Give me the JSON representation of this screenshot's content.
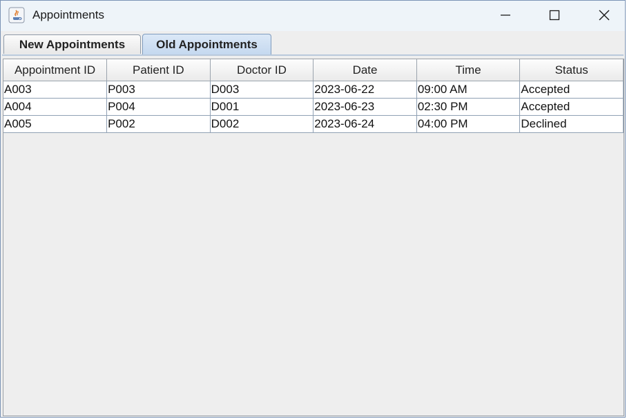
{
  "window": {
    "title": "Appointments",
    "icon": "java-coffee-cup-icon"
  },
  "tabs": [
    {
      "label": "New Appointments",
      "selected": false
    },
    {
      "label": "Old Appointments",
      "selected": true
    }
  ],
  "table": {
    "columns": [
      "Appointment ID",
      "Patient ID",
      "Doctor ID",
      "Date",
      "Time",
      "Status"
    ],
    "rows": [
      [
        "A003",
        "P003",
        "D003",
        "2023-06-22",
        "09:00 AM",
        "Accepted"
      ],
      [
        "A004",
        "P004",
        "D001",
        "2023-06-23",
        "02:30 PM",
        "Accepted"
      ],
      [
        "A005",
        "P002",
        "D002",
        "2023-06-24",
        "04:00 PM",
        "Declined"
      ]
    ]
  },
  "colors": {
    "accent_tab": "#c4d8ef",
    "titlebar": "#eef4f9",
    "panel": "#eeeeee"
  }
}
